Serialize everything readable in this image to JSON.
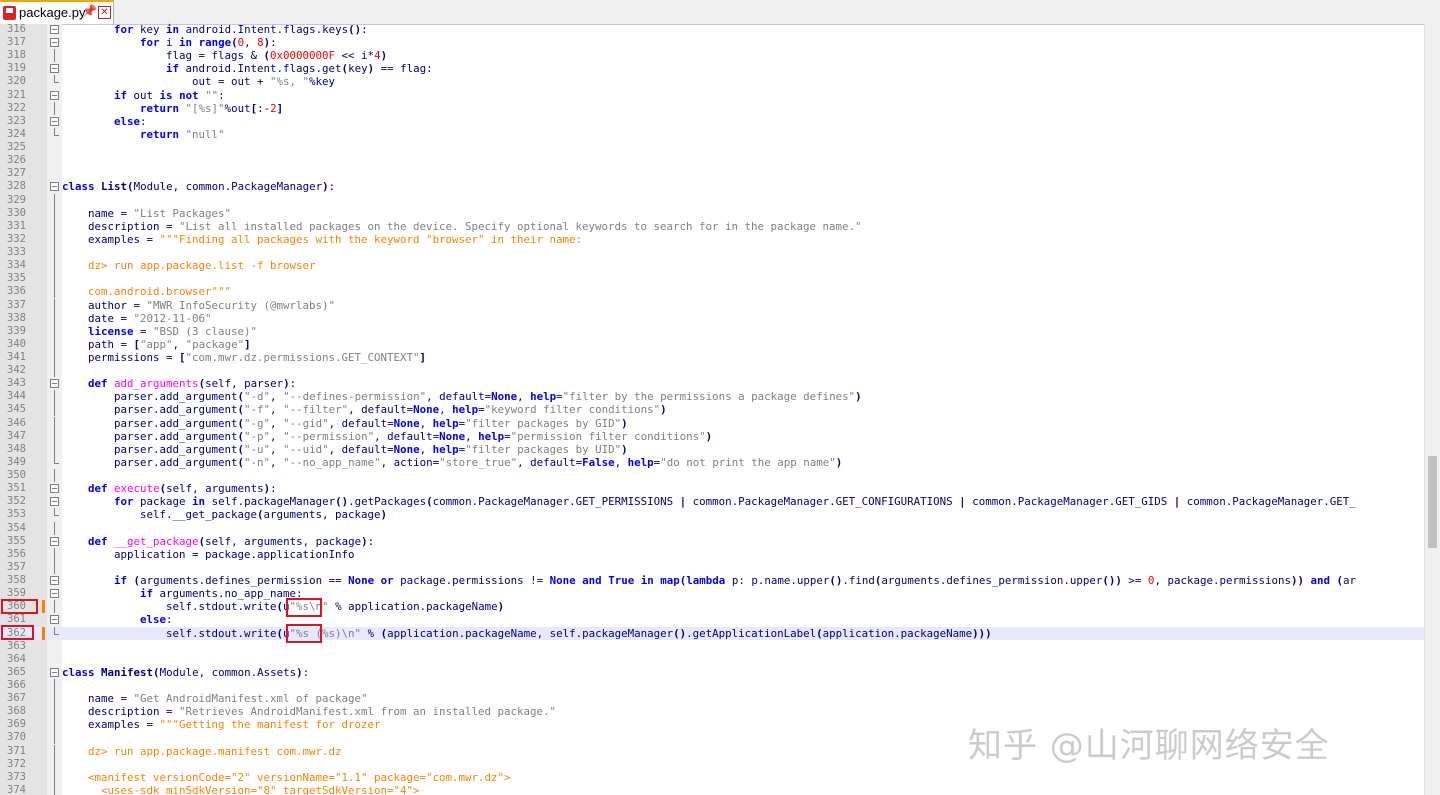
{
  "tab": {
    "filename": "package.py",
    "pin_icon": "pin-icon",
    "close_icon": "close-icon"
  },
  "watermark": "知乎 @山河聊网络安全",
  "colors": {
    "keyword": "#0000ff",
    "string": "#808080",
    "number": "#ff0000",
    "triple_string": "#ff8000",
    "default": "#000080",
    "highlight_line": "#e8e8ff",
    "change_marker": "#ff8000",
    "annotation_box": "#e0141e"
  },
  "lines": [
    {
      "n": "316",
      "fold": "box",
      "html": "        <span class='k'>for</span> key <span class='k'>in</span> android.Intent.flags.keys<span class='b'>()</span>:"
    },
    {
      "n": "317",
      "fold": "box",
      "html": "            <span class='k'>for</span> i <span class='k'>in</span> <span class='k'>range</span><span class='b'>(</span><span class='n'>0</span>, <span class='n'>8</span><span class='b'>)</span>:"
    },
    {
      "n": "318",
      "fold": "bar",
      "html": "                flag = flags &amp; <span class='b'>(</span><span class='n'>0x0000000F</span> &lt;&lt; i*<span class='n'>4</span><span class='b'>)</span>"
    },
    {
      "n": "319",
      "fold": "box",
      "html": "                <span class='k'>if</span> android.Intent.flags.get<span class='b'>(</span>key<span class='b'>)</span> == flag:"
    },
    {
      "n": "320",
      "fold": "end",
      "html": "                    out = out + <span class='s'>\"%s, \"</span>%key"
    },
    {
      "n": "321",
      "fold": "box",
      "html": "        <span class='k'>if</span> out <span class='k'>is</span> <span class='k'>not</span> <span class='s'>\"\"</span>:"
    },
    {
      "n": "322",
      "fold": "bar",
      "html": "            <span class='k'>return</span> <span class='s'>\"[%s]\"</span>%out<span class='b'>[</span>:-<span class='n'>2</span><span class='b'>]</span>"
    },
    {
      "n": "323",
      "fold": "box",
      "html": "        <span class='k'>else</span>:"
    },
    {
      "n": "324",
      "fold": "end",
      "html": "            <span class='k'>return</span> <span class='s'>\"null\"</span>"
    },
    {
      "n": "325",
      "fold": "",
      "html": ""
    },
    {
      "n": "326",
      "fold": "",
      "html": ""
    },
    {
      "n": "327",
      "fold": "",
      "html": ""
    },
    {
      "n": "328",
      "fold": "box",
      "html": "<span class='k'>class</span> <span class='b'>List</span><span class='b'>(</span>Module, common.PackageManager<span class='b'>)</span>:"
    },
    {
      "n": "329",
      "fold": "bar",
      "html": ""
    },
    {
      "n": "330",
      "fold": "bar",
      "html": "    name = <span class='s'>\"List Packages\"</span>"
    },
    {
      "n": "331",
      "fold": "bar",
      "html": "    description = <span class='s'>\"List all installed packages on the device. Specify optional keywords to search for in the package name.\"</span>"
    },
    {
      "n": "332",
      "fold": "bar",
      "html": "    examples = <span class='t'>\"\"\"Finding all packages with the keyword \"browser\" in their name:</span>"
    },
    {
      "n": "333",
      "fold": "bar",
      "html": ""
    },
    {
      "n": "334",
      "fold": "bar",
      "html": "<span class='t'>    dz&gt; run app.package.list -f browser</span>"
    },
    {
      "n": "335",
      "fold": "bar",
      "html": ""
    },
    {
      "n": "336",
      "fold": "bar",
      "html": "<span class='t'>    com.android.browser\"\"\"</span>"
    },
    {
      "n": "337",
      "fold": "bar",
      "html": "    author = <span class='s'>\"MWR InfoSecurity (@mwrlabs)\"</span>"
    },
    {
      "n": "338",
      "fold": "bar",
      "html": "    date = <span class='s'>\"2012-11-06\"</span>"
    },
    {
      "n": "339",
      "fold": "bar",
      "html": "    <span class='k'>license</span> = <span class='s'>\"BSD (3 clause)\"</span>"
    },
    {
      "n": "340",
      "fold": "bar",
      "html": "    path = <span class='b'>[</span><span class='s'>\"app\"</span>, <span class='s'>\"package\"</span><span class='b'>]</span>"
    },
    {
      "n": "341",
      "fold": "bar",
      "html": "    permissions = <span class='b'>[</span><span class='s'>\"com.mwr.dz.permissions.GET_CONTEXT\"</span><span class='b'>]</span>"
    },
    {
      "n": "342",
      "fold": "bar",
      "html": ""
    },
    {
      "n": "343",
      "fold": "box",
      "html": "    <span class='k'>def</span> <span class='d'>add_arguments</span><span class='b'>(</span>self, parser<span class='b'>)</span>:"
    },
    {
      "n": "344",
      "fold": "bar",
      "html": "        parser.add_argument<span class='b'>(</span><span class='s'>\"-d\"</span>, <span class='s'>\"--defines-permission\"</span>, default=<span class='k'>None</span>, <span class='k'>help</span>=<span class='s'>\"filter by the permissions a package defines\"</span><span class='b'>)</span>"
    },
    {
      "n": "345",
      "fold": "bar",
      "html": "        parser.add_argument<span class='b'>(</span><span class='s'>\"-f\"</span>, <span class='s'>\"--filter\"</span>, default=<span class='k'>None</span>, <span class='k'>help</span>=<span class='s'>\"keyword filter conditions\"</span><span class='b'>)</span>"
    },
    {
      "n": "346",
      "fold": "bar",
      "html": "        parser.add_argument<span class='b'>(</span><span class='s'>\"-g\"</span>, <span class='s'>\"--gid\"</span>, default=<span class='k'>None</span>, <span class='k'>help</span>=<span class='s'>\"filter packages by GID\"</span><span class='b'>)</span>"
    },
    {
      "n": "347",
      "fold": "bar",
      "html": "        parser.add_argument<span class='b'>(</span><span class='s'>\"-p\"</span>, <span class='s'>\"--permission\"</span>, default=<span class='k'>None</span>, <span class='k'>help</span>=<span class='s'>\"permission filter conditions\"</span><span class='b'>)</span>"
    },
    {
      "n": "348",
      "fold": "bar",
      "html": "        parser.add_argument<span class='b'>(</span><span class='s'>\"-u\"</span>, <span class='s'>\"--uid\"</span>, default=<span class='k'>None</span>, <span class='k'>help</span>=<span class='s'>\"filter packages by UID\"</span><span class='b'>)</span>"
    },
    {
      "n": "349",
      "fold": "end",
      "html": "        parser.add_argument<span class='b'>(</span><span class='s'>\"-n\"</span>, <span class='s'>\"--no_app_name\"</span>, action=<span class='s'>\"store_true\"</span>, default=<span class='k'>False</span>, <span class='k'>help</span>=<span class='s'>\"do not print the app name\"</span><span class='b'>)</span>"
    },
    {
      "n": "350",
      "fold": "bar",
      "html": ""
    },
    {
      "n": "351",
      "fold": "box",
      "html": "    <span class='k'>def</span> <span class='d'>execute</span><span class='b'>(</span>self, arguments<span class='b'>)</span>:"
    },
    {
      "n": "352",
      "fold": "box",
      "html": "        <span class='k'>for</span> package <span class='k'>in</span> self.packageManager<span class='b'>()</span>.getPackages<span class='b'>(</span>common.PackageManager.GET_PERMISSIONS <span class='b'>|</span> common.PackageManager.GET_CONFIGURATIONS <span class='b'>|</span> common.PackageManager.GET_GIDS <span class='b'>|</span> common.PackageManager.GET_"
    },
    {
      "n": "353",
      "fold": "end",
      "html": "            self.__get_package<span class='b'>(</span>arguments, package<span class='b'>)</span>"
    },
    {
      "n": "354",
      "fold": "bar",
      "html": ""
    },
    {
      "n": "355",
      "fold": "box",
      "html": "    <span class='k'>def</span> <span class='d'>__get_package</span><span class='b'>(</span>self, arguments, package<span class='b'>)</span>:"
    },
    {
      "n": "356",
      "fold": "bar",
      "html": "        application = package.applicationInfo"
    },
    {
      "n": "357",
      "fold": "bar",
      "html": ""
    },
    {
      "n": "358",
      "fold": "box",
      "html": "        <span class='k'>if</span> <span class='b'>(</span>arguments.defines_permission == <span class='k'>None</span> <span class='k'>or</span> package.permissions != <span class='k'>None</span> <span class='k'>and</span> <span class='k'>True</span> <span class='k'>in</span> <span class='k'>map</span><span class='b'>(</span><span class='k'>lambda</span> p: p.name.upper<span class='b'>()</span>.find<span class='b'>(</span>arguments.defines_permission.upper<span class='b'>())</span> &gt;= <span class='n'>0</span>, package.permissions<span class='b'>))</span> <span class='k'>and</span> <span class='b'>(</span>ar"
    },
    {
      "n": "359",
      "fold": "box",
      "html": "            <span class='k'>if</span> arguments.no_app_name:"
    },
    {
      "n": "360",
      "fold": "bar",
      "html": "                self.stdout.write<span class='b'>(</span>u<span class='s'>\"%s\\n\"</span> % application.packageName<span class='b'>)</span>",
      "change": true
    },
    {
      "n": "361",
      "fold": "box",
      "html": "            <span class='k'>else</span>:"
    },
    {
      "n": "362",
      "fold": "end",
      "html": "                self.stdout.write<span class='b'>(</span>u<span class='s'>\"%s (%s)\\n\"</span> % <span class='b'>(</span>application.packageName, self.packageManager<span class='b'>()</span>.getApplicationLabel<span class='b'>(</span>application.packageName<span class='b'>)))</span>",
      "change": true,
      "highlight": true
    },
    {
      "n": "363",
      "fold": "",
      "html": ""
    },
    {
      "n": "364",
      "fold": "",
      "html": ""
    },
    {
      "n": "365",
      "fold": "box",
      "html": "<span class='k'>class</span> <span class='b'>Manifest</span><span class='b'>(</span>Module, common.Assets<span class='b'>)</span>:"
    },
    {
      "n": "366",
      "fold": "bar",
      "html": ""
    },
    {
      "n": "367",
      "fold": "bar",
      "html": "    name = <span class='s'>\"Get AndroidManifest.xml of package\"</span>"
    },
    {
      "n": "368",
      "fold": "bar",
      "html": "    description = <span class='s'>\"Retrieves AndroidManifest.xml from an installed package.\"</span>"
    },
    {
      "n": "369",
      "fold": "bar",
      "html": "    examples = <span class='t'>\"\"\"Getting the manifest for drozer</span>"
    },
    {
      "n": "370",
      "fold": "bar",
      "html": ""
    },
    {
      "n": "371",
      "fold": "bar",
      "html": "<span class='t'>    dz&gt; run app.package.manifest com.mwr.dz</span>"
    },
    {
      "n": "372",
      "fold": "bar",
      "html": ""
    },
    {
      "n": "373",
      "fold": "bar",
      "html": "<span class='t'>    &lt;manifest versionCode=\"2\" versionName=\"1.1\" package=\"com.mwr.dz\"&gt;</span>"
    },
    {
      "n": "374",
      "fold": "bar",
      "html": "<span class='t'>      &lt;uses-sdk minSdkVersion=\"8\" targetSdkVersion=\"4\"&gt;</span>"
    }
  ]
}
